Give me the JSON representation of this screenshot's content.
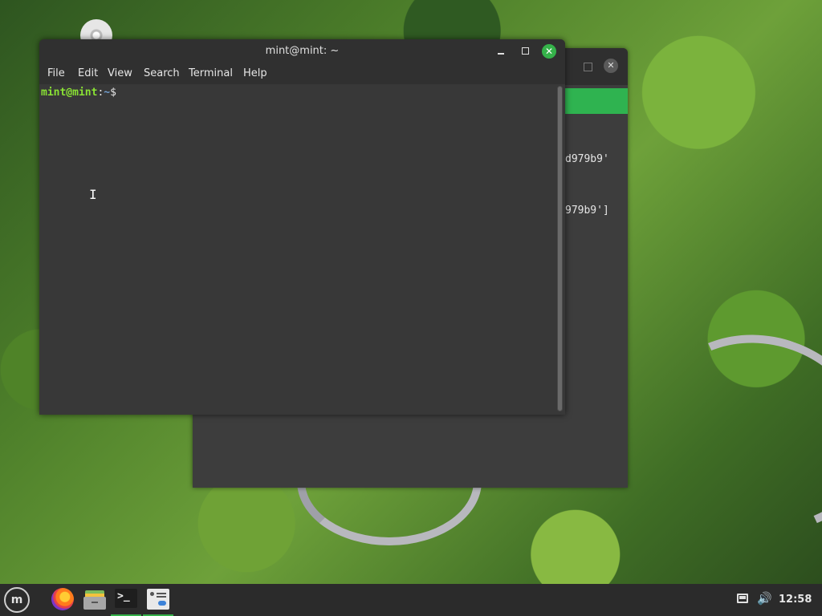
{
  "desktop": {
    "icons": [
      {
        "name": "disc-icon"
      }
    ]
  },
  "back_window": {
    "close_glyph": "✕",
    "lines": [
      "d979b9'",
      "979b9']"
    ],
    "accent": "#2fb350"
  },
  "terminal": {
    "title": "mint@mint: ~",
    "buttons": {
      "close_glyph": "✕"
    },
    "menu": [
      "File",
      "Edit",
      "View",
      "Search",
      "Terminal",
      "Help"
    ],
    "prompt": {
      "user_host": "mint@mint",
      "sep": ":",
      "path": "~",
      "symbol": "$"
    },
    "cursor_glyph": "I",
    "colors": {
      "user": "#8ae234",
      "path": "#729fcf",
      "background": "#383838"
    }
  },
  "taskbar": {
    "menu_glyph": "m",
    "apps": [
      {
        "name": "firefox-icon",
        "active": false
      },
      {
        "name": "files-icon",
        "active": false
      },
      {
        "name": "terminal-icon",
        "active": true,
        "glyph": ">_"
      },
      {
        "name": "settings-icon",
        "active": true
      }
    ],
    "volume_glyph": "🔊",
    "clock": "12:58",
    "accent": "#35b24a"
  }
}
